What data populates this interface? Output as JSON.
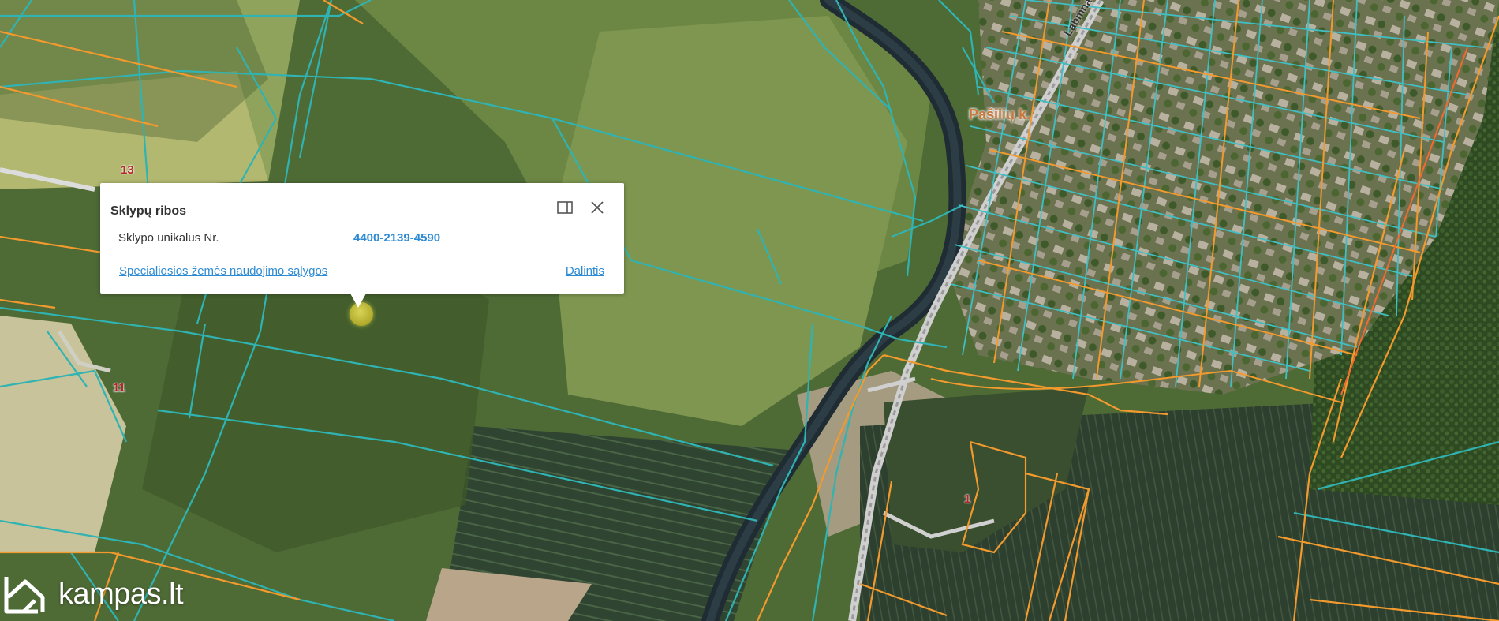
{
  "popup": {
    "title": "Sklypų ribos",
    "label": "Sklypo unikalus Nr.",
    "value": "4400-2139-4590",
    "link_special": "Specialiosios žemės naudojimo sąlygos",
    "link_share": "Dalintis",
    "dock_icon": "dock-panel-icon",
    "close_icon": "close-icon"
  },
  "map": {
    "place_label": "Pašilių k.",
    "road_label": "Labmna",
    "parcel_numbers": [
      "13",
      "11",
      "1"
    ],
    "colors": {
      "parcel_line": "#2fb3b3",
      "cadastral_line": "#f29a2e",
      "river": "#1d2a33",
      "field_light": "#8ea55a",
      "field_dark": "#3a4a2a"
    }
  },
  "logo": {
    "text": "kampas.lt",
    "icon": "house-k-logo-icon"
  }
}
